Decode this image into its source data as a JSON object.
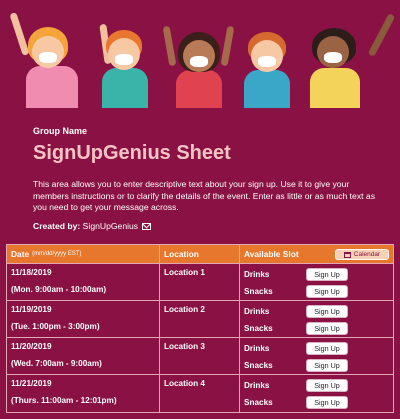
{
  "header": {
    "group_name": "Group Name",
    "title": "SignUpGenius Sheet",
    "description": "This area allows you to enter descriptive text about your sign up. Use it to give your members instructions or to clarify the details of the event. Enter as little or as much text as you need to get your message across.",
    "created_by_label": "Created by:",
    "created_by_name": "SignUpGenius",
    "email_icon": "envelope-icon"
  },
  "colors": {
    "background": "#8a1143",
    "title": "#f6c4c4",
    "table_header": "#e7772c",
    "border": "#e2a8b4"
  },
  "table": {
    "headers": {
      "date": "Date",
      "date_format": "(mm/dd/yyyy EST)",
      "location": "Location",
      "slot": "Available Slot",
      "calendar_button": "Calendar"
    },
    "rows": [
      {
        "date": "11/18/2019",
        "time": "(Mon. 9:00am - 10:00am)",
        "location": "Location 1",
        "slots": [
          {
            "name": "Drinks",
            "button": "Sign Up"
          },
          {
            "name": "Snacks",
            "button": "Sign Up"
          }
        ]
      },
      {
        "date": "11/19/2019",
        "time": "(Tue. 1:00pm - 3:00pm)",
        "location": "Location 2",
        "slots": [
          {
            "name": "Drinks",
            "button": "Sign Up"
          },
          {
            "name": "Snacks",
            "button": "Sign Up"
          }
        ]
      },
      {
        "date": "11/20/2019",
        "time": "(Wed. 7:00am - 9:00am)",
        "location": "Location 3",
        "slots": [
          {
            "name": "Drinks",
            "button": "Sign Up"
          },
          {
            "name": "Snacks",
            "button": "Sign Up"
          }
        ]
      },
      {
        "date": "11/21/2019",
        "time": "(Thurs. 11:00am - 12:01pm)",
        "location": "Location 4",
        "slots": [
          {
            "name": "Drinks",
            "button": "Sign Up"
          },
          {
            "name": "Snacks",
            "button": "Sign Up"
          }
        ]
      }
    ]
  }
}
